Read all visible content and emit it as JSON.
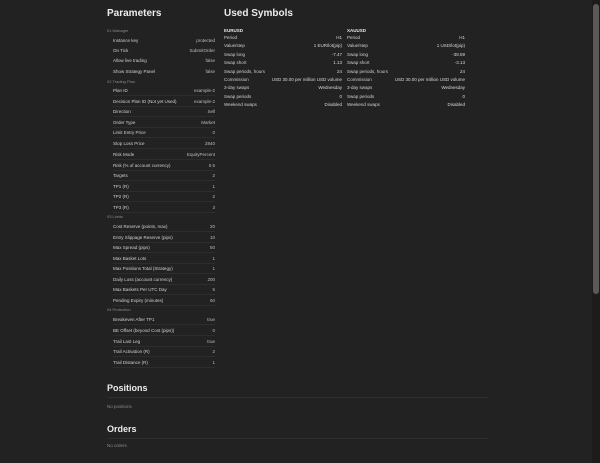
{
  "parameters": {
    "title": "Parameters",
    "groups": [
      {
        "label": "01 Manager",
        "rows": [
          {
            "label": "Instance key",
            "value": "protected"
          },
          {
            "label": "On Tick",
            "value": "SubmitOrder"
          },
          {
            "label": "Allow live trading",
            "value": "false"
          },
          {
            "label": "Show Strategy Panel",
            "value": "false"
          }
        ]
      },
      {
        "label": "02 Trading Plan",
        "rows": [
          {
            "label": "Plan ID",
            "value": "example-2"
          },
          {
            "label": "Decision Plan ID (Not yet Used)",
            "value": "example-2"
          },
          {
            "label": "Direction",
            "value": "Sell"
          },
          {
            "label": "Order Type",
            "value": "Market"
          },
          {
            "label": "Limit Entry Price",
            "value": "0"
          },
          {
            "label": "Stop Loss Price",
            "value": "2840"
          },
          {
            "label": "Risk Mode",
            "value": "EquityPercent"
          },
          {
            "label": "Risk (% of account currency)",
            "value": "0.5"
          },
          {
            "label": "Targets",
            "value": "2"
          },
          {
            "label": "TP1 (R)",
            "value": "1"
          },
          {
            "label": "TP2 (R)",
            "value": "2"
          },
          {
            "label": "TP3 (R)",
            "value": "3"
          }
        ]
      },
      {
        "label": "03 Limits",
        "rows": [
          {
            "label": "Cost Reserve (points, max)",
            "value": "20"
          },
          {
            "label": "Entry Slippage Reserve (pips)",
            "value": "10"
          },
          {
            "label": "Max Spread (pips)",
            "value": "50"
          },
          {
            "label": "Max Basket Lots",
            "value": "1"
          },
          {
            "label": "Max Positions Total (Strategy)",
            "value": "1"
          },
          {
            "label": "Daily Loss (account currency)",
            "value": "200"
          },
          {
            "label": "Max Baskets Per UTC Day",
            "value": "5"
          },
          {
            "label": "Pending Expiry (minutes)",
            "value": "60"
          }
        ]
      },
      {
        "label": "04 Protection",
        "rows": [
          {
            "label": "Breakeven After TP1",
            "value": "true"
          },
          {
            "label": "BE Offset (beyond Cost (pips))",
            "value": "0"
          },
          {
            "label": "Trail Last Leg",
            "value": "true"
          },
          {
            "label": "Trail Activation (R)",
            "value": "2"
          },
          {
            "label": "Trail Distance (R)",
            "value": "1"
          }
        ]
      }
    ]
  },
  "used_symbols": {
    "title": "Used Symbols",
    "symbols": [
      {
        "name": "EURUSD",
        "rows": [
          {
            "label": "Period",
            "value": "H1"
          },
          {
            "label": "Value/step",
            "value": "1 EUR/lot(pip)"
          },
          {
            "label": "Swap long",
            "value": "-7.47"
          },
          {
            "label": "Swap short",
            "value": "1.13"
          },
          {
            "label": "Swap periods, hours",
            "value": "24"
          },
          {
            "label": "Commission",
            "value": "USD 30.00 per million USD volume"
          },
          {
            "label": "3-day swaps",
            "value": "Wednesday"
          },
          {
            "label": "Swap periods",
            "value": "0"
          },
          {
            "label": "Weekend swaps",
            "value": "Disabled"
          }
        ]
      },
      {
        "name": "XAUUSD",
        "rows": [
          {
            "label": "Period",
            "value": "H1"
          },
          {
            "label": "Value/step",
            "value": "1 USD/lot(pip)"
          },
          {
            "label": "Swap long",
            "value": "-38.59"
          },
          {
            "label": "Swap short",
            "value": "-3.13"
          },
          {
            "label": "Swap periods, hours",
            "value": "24"
          },
          {
            "label": "Commission",
            "value": "USD 30.00 per million USD volume"
          },
          {
            "label": "3-day swaps",
            "value": "Wednesday"
          },
          {
            "label": "Swap periods",
            "value": "0"
          },
          {
            "label": "Weekend swaps",
            "value": "Disabled"
          }
        ]
      }
    ]
  },
  "positions": {
    "title": "Positions",
    "empty": "No positions"
  },
  "orders": {
    "title": "Orders",
    "empty": "No orders"
  }
}
